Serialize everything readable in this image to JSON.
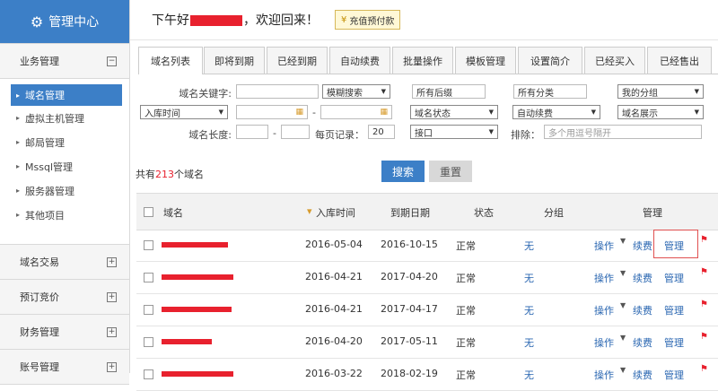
{
  "sidebar": {
    "title": "管理中心",
    "groups": [
      {
        "label": "业务管理",
        "toggle": "⊟"
      },
      {
        "label": "域名交易",
        "toggle": "⊞"
      },
      {
        "label": "预订竞价",
        "toggle": "⊞"
      },
      {
        "label": "财务管理",
        "toggle": "⊞"
      },
      {
        "label": "账号管理",
        "toggle": "⊞"
      }
    ],
    "items": [
      {
        "label": "域名管理"
      },
      {
        "label": "虚拟主机管理"
      },
      {
        "label": "邮局管理"
      },
      {
        "label": "Mssql管理"
      },
      {
        "label": "服务器管理"
      },
      {
        "label": "其他项目"
      }
    ]
  },
  "header": {
    "greeting_prefix": "下午好",
    "greeting_suffix": "，欢迎回来！",
    "recharge_label": "充值预付款"
  },
  "tabs": [
    "域名列表",
    "即将到期",
    "已经到期",
    "自动续费",
    "批量操作",
    "模板管理",
    "设置简介",
    "已经买入",
    "已经售出"
  ],
  "filters": {
    "keyword_label": "域名关键字:",
    "match_select": "模糊搜索",
    "suffix_box": "所有后缀",
    "category_box": "所有分类",
    "group_select": "我的分组",
    "time_select": "入库时间",
    "dash1": "-",
    "status_select": "域名状态",
    "autorenew_select": "自动续费",
    "display_select": "域名展示",
    "length_label": "域名长度:",
    "dash2": "-",
    "per_page_label": "每页记录：",
    "per_page_value": "20",
    "interface_select": "接口",
    "exclude_label": "排除：",
    "exclude_placeholder": "多个用逗号隔开"
  },
  "summary": {
    "prefix": "共有",
    "count": "213",
    "suffix": "个域名"
  },
  "buttons": {
    "search": "搜索",
    "reset": "重置"
  },
  "table": {
    "headers": {
      "domain": "域名",
      "added": "入库时间",
      "expire": "到期日期",
      "status": "状态",
      "group": "分组",
      "manage": "管理"
    },
    "rows": [
      {
        "added": "2016-05-04",
        "expire": "2016-10-15",
        "status": "正常",
        "group": "无",
        "op": "操作",
        "renew": "续费",
        "manage": "管理"
      },
      {
        "added": "2016-04-21",
        "expire": "2017-04-20",
        "status": "正常",
        "group": "无",
        "op": "操作",
        "renew": "续费",
        "manage": "管理"
      },
      {
        "added": "2016-04-21",
        "expire": "2017-04-17",
        "status": "正常",
        "group": "无",
        "op": "操作",
        "renew": "续费",
        "manage": "管理"
      },
      {
        "added": "2016-04-20",
        "expire": "2017-05-11",
        "status": "正常",
        "group": "无",
        "op": "操作",
        "renew": "续费",
        "manage": "管理"
      },
      {
        "added": "2016-03-22",
        "expire": "2018-02-19",
        "status": "正常",
        "group": "无",
        "op": "操作",
        "renew": "续费",
        "manage": "管理"
      }
    ]
  },
  "colors": {
    "accent": "#3c7fc7",
    "redaction": "#e8212e"
  }
}
